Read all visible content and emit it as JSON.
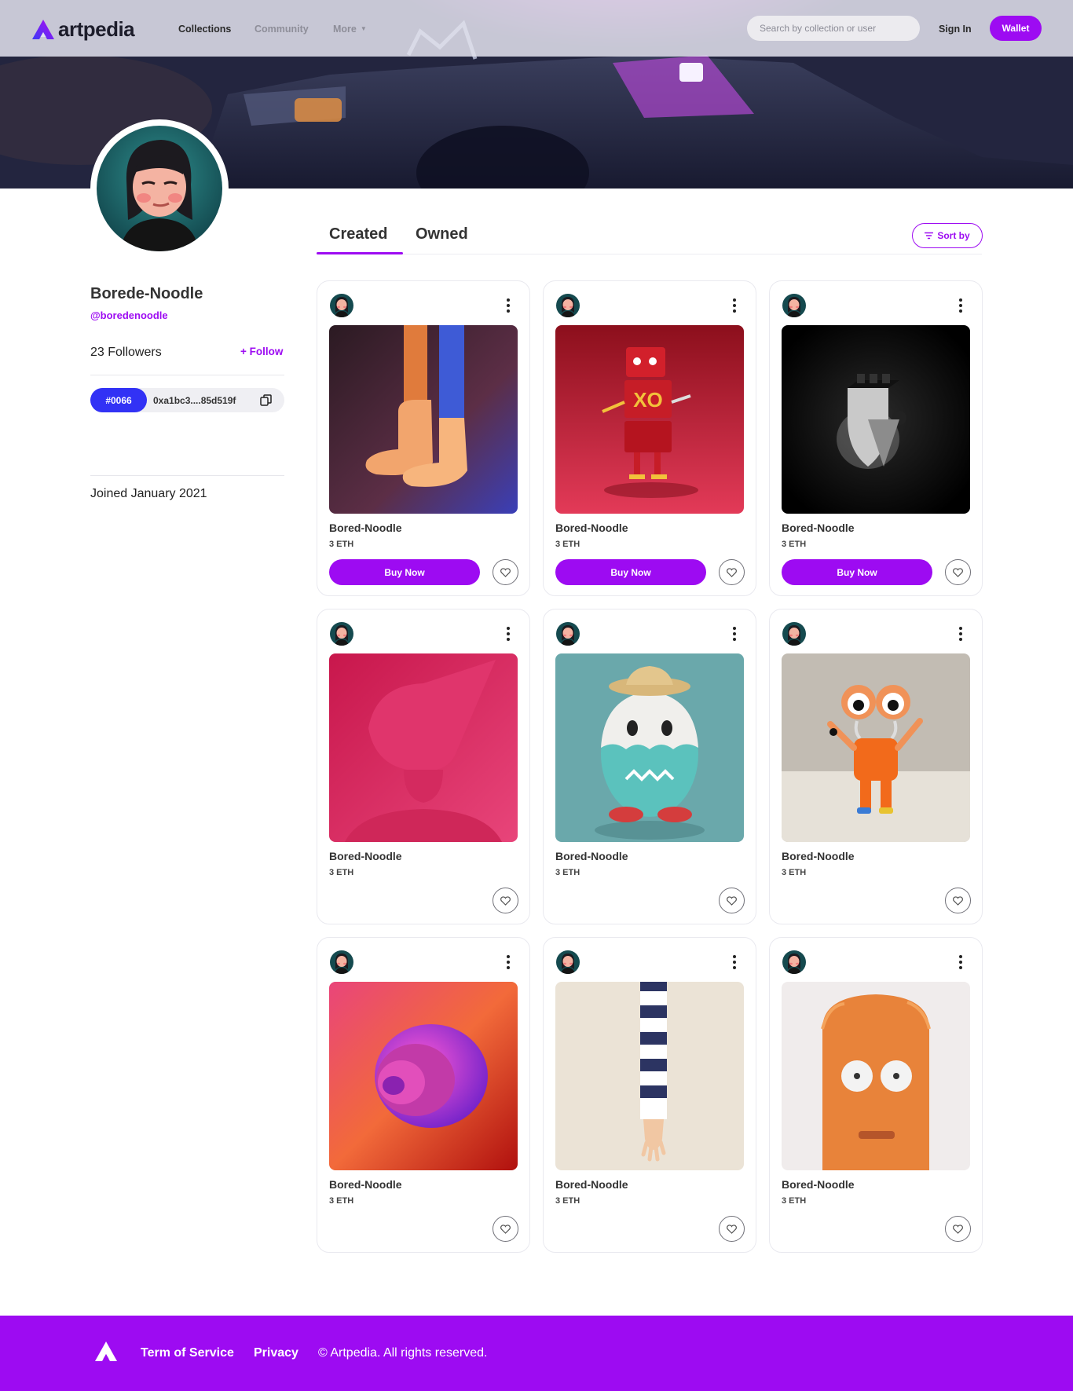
{
  "brand": {
    "name": "artpedia",
    "accent": "#9d0bf2",
    "tag_color": "#3232f5"
  },
  "nav": {
    "links": [
      {
        "label": "Collections",
        "active": true
      },
      {
        "label": "Community",
        "active": false
      },
      {
        "label": "More",
        "active": false
      }
    ],
    "search_placeholder": "Search by collection or user",
    "signin_label": "Sign In",
    "wallet_label": "Wallet",
    "icons": {
      "more": "chevron-down-icon"
    }
  },
  "profile": {
    "name": "Borede-Noodle",
    "handle": "@boredenoodle",
    "followers": "23 Followers",
    "follow_label": "+ Follow",
    "wallet_tag": "#0066",
    "wallet_address": "0xa1bc3....85d519f",
    "copy_icon": "copy-icon",
    "joined": "Joined  January 2021"
  },
  "tabs": [
    {
      "label": "Created",
      "active": true
    },
    {
      "label": "Owned",
      "active": false
    }
  ],
  "sort": {
    "label": "Sort by",
    "icon": "filter-icon"
  },
  "cards": [
    {
      "name": "Bored-Noodle",
      "price": "3 ETH",
      "buy_label": "Buy Now",
      "art": "legs-boots"
    },
    {
      "name": "Bored-Noodle",
      "price": "3 ETH",
      "buy_label": "Buy Now",
      "art": "red-robot"
    },
    {
      "name": "Bored-Noodle",
      "price": "3 ETH",
      "buy_label": "Buy Now",
      "art": "chess-rook"
    },
    {
      "name": "Bored-Noodle",
      "price": "3 ETH",
      "buy_label": "",
      "art": "pink-cone-head"
    },
    {
      "name": "Bored-Noodle",
      "price": "3 ETH",
      "buy_label": "",
      "art": "teal-monster"
    },
    {
      "name": "Bored-Noodle",
      "price": "3 ETH",
      "buy_label": "",
      "art": "eye-character"
    },
    {
      "name": "Bored-Noodle",
      "price": "3 ETH",
      "buy_label": "",
      "art": "purple-swirl"
    },
    {
      "name": "Bored-Noodle",
      "price": "3 ETH",
      "buy_label": "",
      "art": "striped-arm"
    },
    {
      "name": "Bored-Noodle",
      "price": "3 ETH",
      "buy_label": "",
      "art": "fuzzy-orange"
    }
  ],
  "footer": {
    "tos_label": "Term of Service",
    "privacy_label": "Privacy",
    "copyright": "© Artpedia. All rights reserved."
  }
}
